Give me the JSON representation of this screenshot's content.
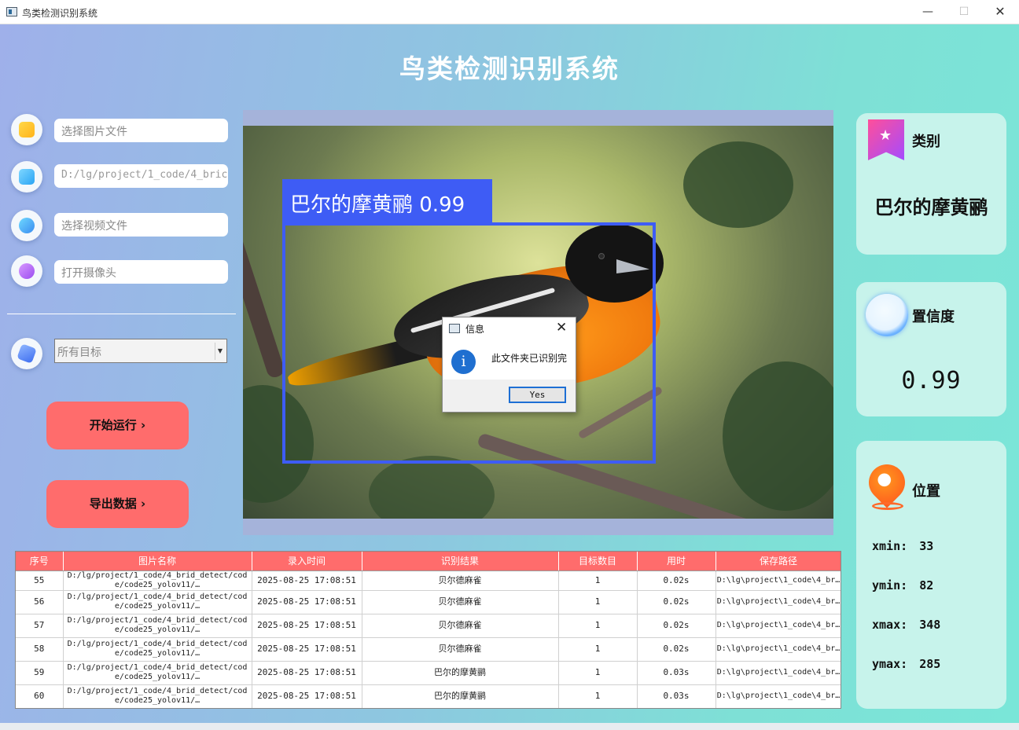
{
  "window": {
    "title": "鸟类检测识别系统",
    "min": "—",
    "max": "☐",
    "close": "✕"
  },
  "header": {
    "title": "鸟类检测识别系统"
  },
  "controls": {
    "image_file": {
      "placeholder": "选择图片文件",
      "icon": "image-file-icon"
    },
    "folder": {
      "value": "D:/lg/project/1_code/4_bric",
      "icon": "folder-file-icon"
    },
    "video_file": {
      "placeholder": "选择视频文件",
      "icon": "video-file-icon"
    },
    "camera": {
      "placeholder": "打开摄像头",
      "icon": "camera-icon"
    },
    "target_select": {
      "value": "所有目标",
      "arrow": "▼",
      "icon": "target-icon"
    },
    "run_button": "开始运行 ›",
    "export_button": "导出数据 ›"
  },
  "detection": {
    "label": "巴尔的摩黄鹂 0.99",
    "box_color": "#3e5cf5"
  },
  "result": {
    "class_title": "类别",
    "class_value": "巴尔的摩黄鹂",
    "conf_title": "置信度",
    "conf_value": "0.99",
    "pos_title": "位置",
    "positions": [
      {
        "label": "xmin:",
        "value": "33"
      },
      {
        "label": "ymin:",
        "value": "82"
      },
      {
        "label": "xmax:",
        "value": "348"
      },
      {
        "label": "ymax:",
        "value": "285"
      }
    ]
  },
  "table": {
    "headers": [
      "序号",
      "图片名称",
      "录入时间",
      "识别结果",
      "目标数目",
      "用时",
      "保存路径"
    ],
    "rows": [
      [
        "55",
        "D:/lg/project/1_code/4_brid_detect/code/code25_yolov11/…",
        "2025-08-25 17:08:51",
        "贝尔德麻雀",
        "1",
        "0.02s",
        "D:\\lg\\project\\1_code\\4_br…"
      ],
      [
        "56",
        "D:/lg/project/1_code/4_brid_detect/code/code25_yolov11/…",
        "2025-08-25 17:08:51",
        "贝尔德麻雀",
        "1",
        "0.02s",
        "D:\\lg\\project\\1_code\\4_br…"
      ],
      [
        "57",
        "D:/lg/project/1_code/4_brid_detect/code/code25_yolov11/…",
        "2025-08-25 17:08:51",
        "贝尔德麻雀",
        "1",
        "0.02s",
        "D:\\lg\\project\\1_code\\4_br…"
      ],
      [
        "58",
        "D:/lg/project/1_code/4_brid_detect/code/code25_yolov11/…",
        "2025-08-25 17:08:51",
        "贝尔德麻雀",
        "1",
        "0.02s",
        "D:\\lg\\project\\1_code\\4_br…"
      ],
      [
        "59",
        "D:/lg/project/1_code/4_brid_detect/code/code25_yolov11/…",
        "2025-08-25 17:08:51",
        "巴尔的摩黄鹂",
        "1",
        "0.03s",
        "D:\\lg\\project\\1_code\\4_br…"
      ],
      [
        "60",
        "D:/lg/project/1_code/4_brid_detect/code/code25_yolov11/…",
        "2025-08-25 17:08:51",
        "巴尔的摩黄鹂",
        "1",
        "0.03s",
        "D:\\lg\\project\\1_code\\4_br…"
      ]
    ]
  },
  "dialog": {
    "title": "信息",
    "message": "此文件夹已识别完",
    "yes": "Yes",
    "close": "✕",
    "info_glyph": "i"
  }
}
